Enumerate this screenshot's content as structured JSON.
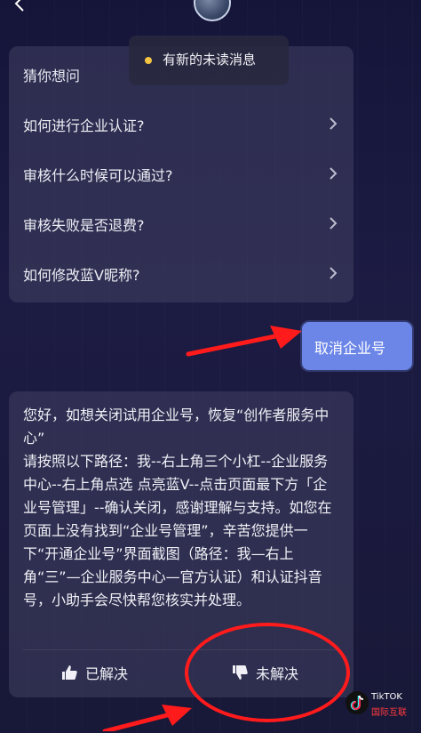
{
  "top": {
    "avatar_icon": "avatar"
  },
  "toast": {
    "text": "有新的未读消息",
    "dot_color": "#f4c542"
  },
  "suggest": {
    "title": "猜你想问",
    "items": [
      {
        "label": "如何进行企业认证?"
      },
      {
        "label": "审核什么时候可以通过?"
      },
      {
        "label": "审核失败是否退费?"
      },
      {
        "label": "如何修改蓝V昵称?"
      }
    ]
  },
  "user_message": {
    "text": "取消企业号"
  },
  "answer": {
    "text": "您好，如想关闭试用企业号，恢复“创作者服务中心”\n请按照以下路径：我--右上角三个小杠--企业服务中心--右上角点选 点亮蓝V--点击页面最下方「企业号管理」--确认关闭，感谢理解与支持。如您在页面上没有找到“企业号管理”，辛苦您提供一下“开通企业号”界面截图（路径：我—右上角“三”—企业服务中心—官方认证）和认证抖音号，小助手会尽快帮您核实并处理。",
    "resolved_label": "已解决",
    "unresolved_label": "未解决"
  },
  "watermark": {
    "line1": "TikTOK",
    "line2": "国际互联"
  },
  "colors": {
    "accent_blue": "#6c86e8",
    "annotation_red": "#ff1b1b"
  }
}
